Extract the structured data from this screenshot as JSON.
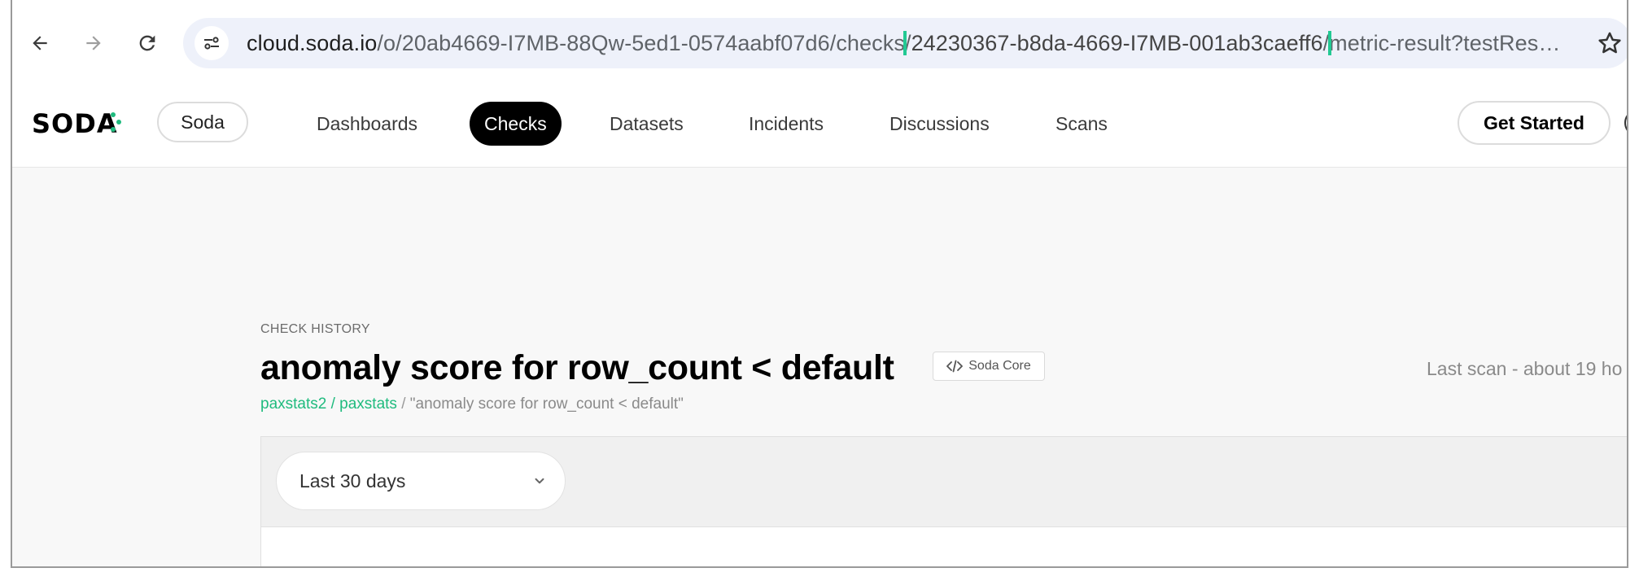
{
  "browser": {
    "url": {
      "host": "cloud.soda.io",
      "path_before": "/o/20ab4669-I7MB-88Qw-5ed1-0574aabf07d6/checks/",
      "highlighted_id": "24230367-b8da-4669-I7MB-001ab3caeff6",
      "path_after": "/metric-result?testRes…"
    },
    "icons": {
      "back": "back-arrow-icon",
      "forward": "forward-arrow-icon",
      "reload": "reload-icon",
      "site_info": "site-settings-icon",
      "bookmark": "star-icon"
    },
    "highlight_color": "#22c993"
  },
  "app": {
    "logo_text": "SODA",
    "org_label": "Soda",
    "nav": [
      {
        "label": "Dashboards",
        "active": false
      },
      {
        "label": "Checks",
        "active": true
      },
      {
        "label": "Datasets",
        "active": false
      },
      {
        "label": "Incidents",
        "active": false
      },
      {
        "label": "Discussions",
        "active": false
      },
      {
        "label": "Scans",
        "active": false
      }
    ],
    "get_started_label": "Get Started",
    "accent_color": "#1fbb7e"
  },
  "check": {
    "eyebrow": "CHECK HISTORY",
    "title": "anomaly score for row_count < default",
    "source_badge": "Soda Core",
    "last_scan": "Last scan - about 19 ho",
    "breadcrumb": {
      "dataset_path": "paxstats2 / paxstats",
      "separator": " / ",
      "current": "\"anomaly score for row_count < default\""
    },
    "time_range": "Last 30 days"
  }
}
